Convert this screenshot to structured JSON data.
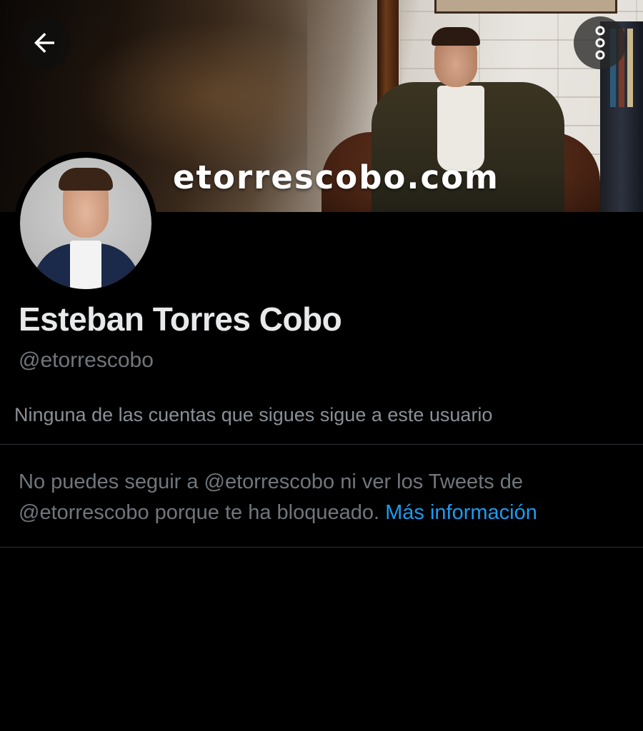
{
  "header": {
    "back_icon": "arrow-left-icon",
    "more_icon": "more-vertical-icon"
  },
  "banner": {
    "text": "etorrescobo.com"
  },
  "profile": {
    "name": "Esteban Torres Cobo",
    "handle": "@etorrescobo",
    "follow_note": "Ninguna de las cuentas que sigues sigue a este usuario"
  },
  "blocked_notice": {
    "text": "No puedes seguir a @etorrescobo ni ver los Tweets de @etorrescobo porque te ha bloqueado. ",
    "link_label": "Más información"
  },
  "colors": {
    "background": "#000000",
    "primary_text": "#e7e9ea",
    "secondary_text": "#71767b",
    "link": "#1d9bf0",
    "divider": "#2f3336"
  }
}
